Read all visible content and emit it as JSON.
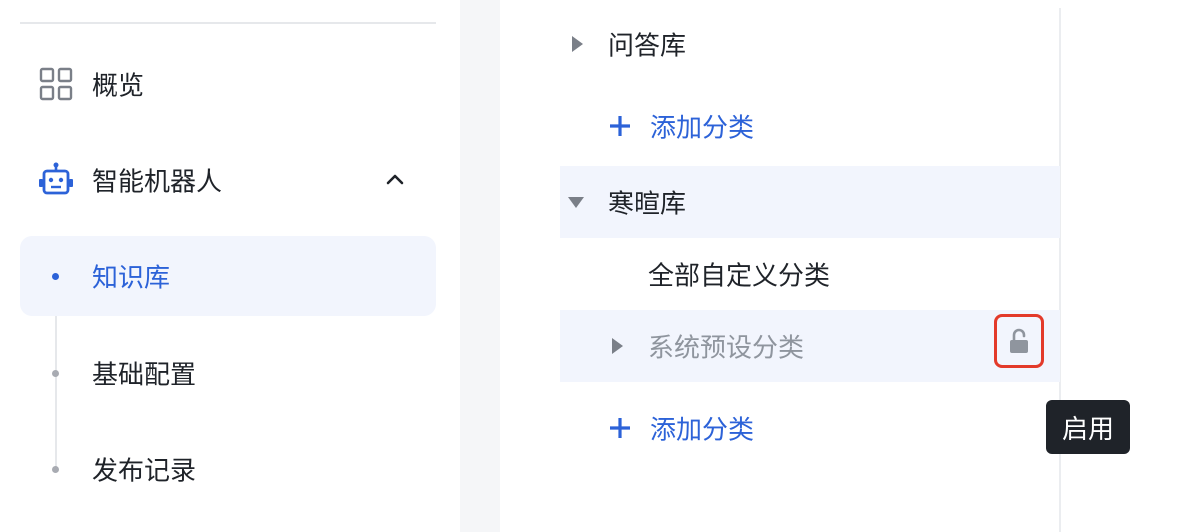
{
  "sidebar": {
    "overview_label": "概览",
    "robot_label": "智能机器人",
    "sub_items": [
      {
        "label": "知识库",
        "active": true
      },
      {
        "label": "基础配置",
        "active": false
      },
      {
        "label": "发布记录",
        "active": false
      }
    ]
  },
  "tree": {
    "qa_lib": "问答库",
    "add_category_1": "添加分类",
    "greeting_lib": "寒暄库",
    "all_custom": "全部自定义分类",
    "system_preset": "系统预设分类",
    "add_category_2": "添加分类"
  },
  "tooltip": {
    "text": "启用"
  },
  "colors": {
    "accent": "#2c62d8",
    "highlight_bg": "#f2f5fd",
    "lock_border": "#e33a2a",
    "tooltip_bg": "#1f2329"
  },
  "icons": {
    "overview": "grid-icon",
    "robot": "robot-icon",
    "expand": "chevron-up-icon",
    "lock": "unlock-icon"
  }
}
